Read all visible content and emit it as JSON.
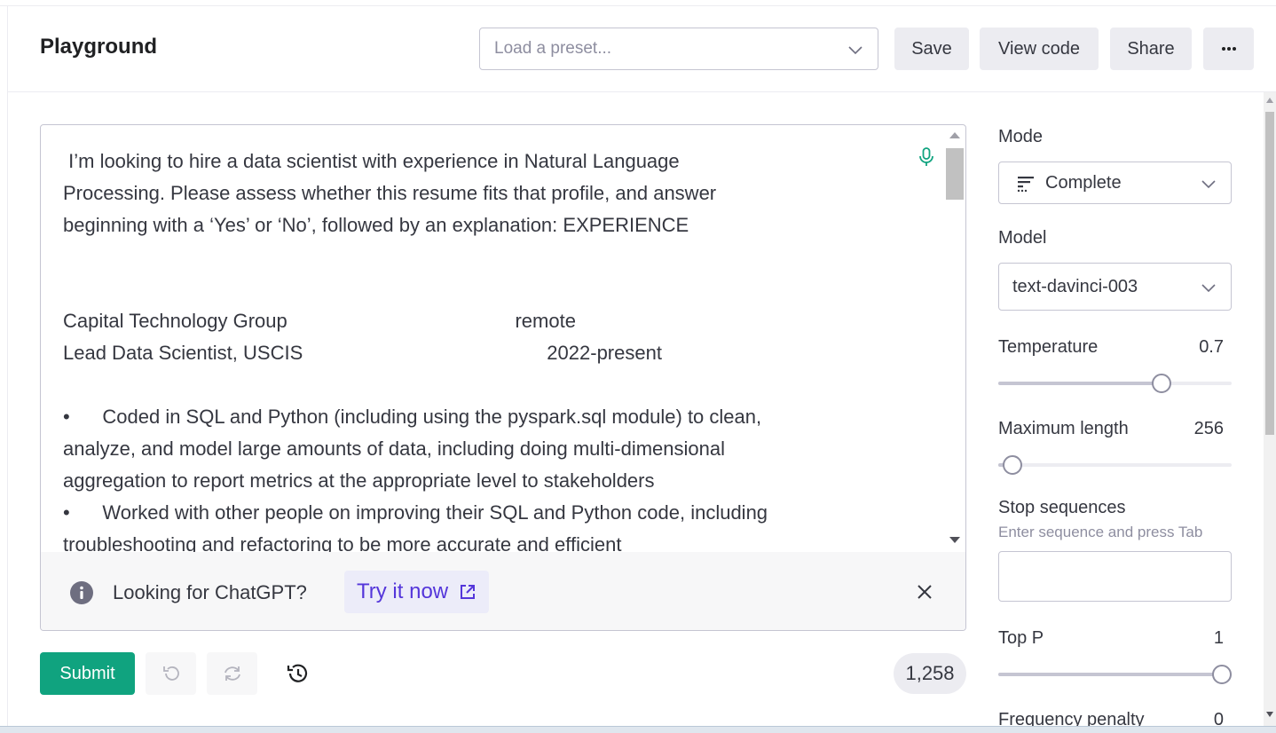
{
  "header": {
    "title": "Playground",
    "preset_placeholder": "Load a preset...",
    "save_label": "Save",
    "view_code_label": "View code",
    "share_label": "Share",
    "more_label": "···"
  },
  "editor": {
    "prompt": " I’m looking to hire a data scientist with experience in Natural Language\nProcessing. Please assess whether this resume fits that profile, and answer\nbeginning with a ‘Yes’ or ‘No’, followed by an explanation: EXPERIENCE\n\n\nCapital Technology Group                                          remote\nLead Data Scientist, USCIS                                             2022-present\n\n•      Coded in SQL and Python (including using the pyspark.sql module) to clean,\nanalyze, and model large amounts of data, including doing multi-dimensional\naggregation to report metrics at the appropriate level to stakeholders\n•      Worked with other people on improving their SQL and Python code, including\ntroubleshooting and refactoring to be more accurate and efficient",
    "banner_text": "Looking for ChatGPT?",
    "banner_link": "Try it now"
  },
  "toolbar": {
    "submit_label": "Submit",
    "token_count": "1,258"
  },
  "settings": {
    "mode_label": "Mode",
    "mode_value": "Complete",
    "model_label": "Model",
    "model_value": "text-davinci-003",
    "temperature_label": "Temperature",
    "temperature_value": "0.7",
    "temperature_fraction": 0.7,
    "max_length_label": "Maximum length",
    "max_length_value": "256",
    "max_length_fraction": 0.06,
    "stop_label": "Stop sequences",
    "stop_hint": "Enter sequence and press Tab",
    "top_p_label": "Top P",
    "top_p_value": "1",
    "top_p_fraction": 1.0,
    "freq_label": "Frequency penalty",
    "freq_value": "0"
  },
  "colors": {
    "accent": "#10a37f",
    "link": "#5436da"
  }
}
